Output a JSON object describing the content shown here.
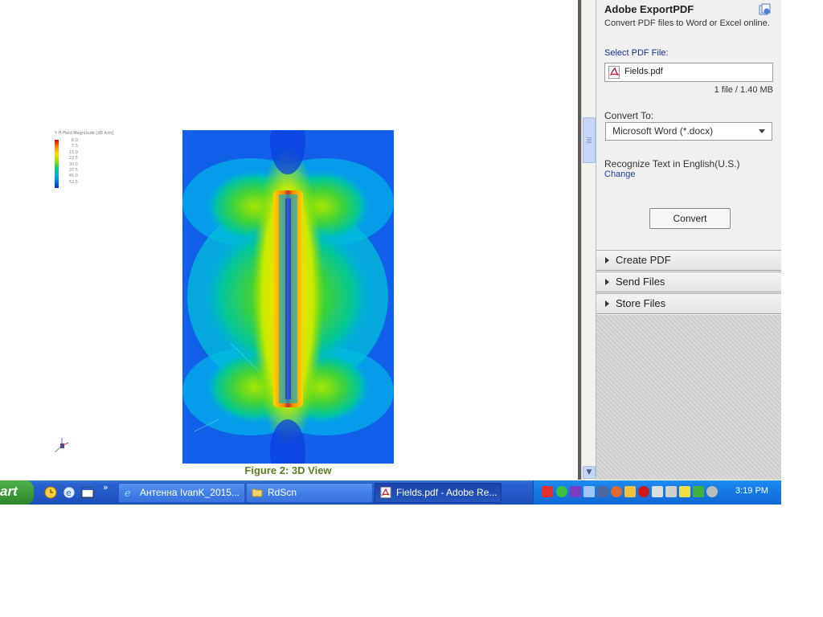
{
  "document": {
    "legend": {
      "title": "Y H-Field Magnitude [dB A/m]",
      "ticks": [
        "6.0",
        "7.5",
        "15.0",
        "22.5",
        "30.0",
        "37.5",
        "45.0",
        "52.5",
        "60.0",
        "67.5"
      ]
    },
    "caption": "Figure 2: 3D View"
  },
  "export_pane": {
    "title": "Adobe ExportPDF",
    "description": "Convert PDF files to Word or Excel online.",
    "select_label": "Select PDF File:",
    "file_name": "Fields.pdf",
    "file_size": "1 file / 1.40 MB",
    "convert_to_label": "Convert To:",
    "convert_to_value": "Microsoft Word (*.docx)",
    "recognize_text": "Recognize Text in English(U.S.)",
    "change_link": "Change",
    "convert_button": "Convert",
    "sections": [
      "Create PDF",
      "Send Files",
      "Store Files"
    ]
  },
  "taskbar": {
    "start_label": "art",
    "quicklaunch_more": "»",
    "tasks": [
      {
        "label": "Антенна IvanK_2015...",
        "icon": "ie-icon",
        "active": false
      },
      {
        "label": "RdScn",
        "icon": "folder-icon",
        "active": false
      },
      {
        "label": "Fields.pdf - Adobe Re...",
        "icon": "pdf-icon",
        "active": true
      }
    ],
    "clock": "3:19 PM"
  },
  "colors": {
    "taskbar_blue": "#2358c7",
    "start_green": "#3a9737",
    "tray_blue": "#1477e3",
    "caption_green": "#5b7f22",
    "link_blue": "#1b3b9b"
  }
}
